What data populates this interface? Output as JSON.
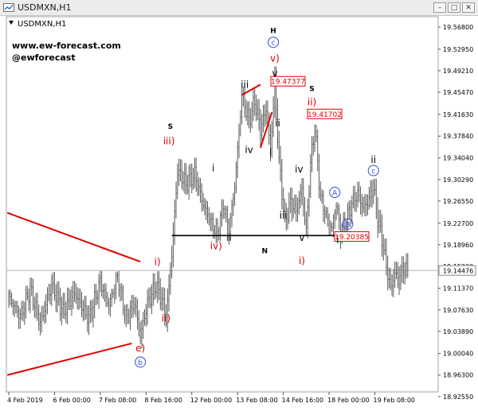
{
  "window": {
    "title": "USDMXN,H1",
    "buttons": [
      "minimize",
      "maximize",
      "close"
    ]
  },
  "chart_data": {
    "type": "candlestick",
    "symbol_label": "USDMXN,H1",
    "watermark": [
      "www.ew-forecast.com",
      "@ewforecast"
    ],
    "ylim": [
      18.935,
      19.575
    ],
    "y_ticks": [
      "19.56800",
      "19.52950",
      "19.49210",
      "19.45470",
      "19.41630",
      "19.37840",
      "19.34040",
      "19.30290",
      "19.26550",
      "19.22700",
      "19.18960",
      "19.15220",
      "19.11370",
      "19.07630",
      "19.03890",
      "19.00040",
      "18.96300",
      "18.92550"
    ],
    "y_tick_values": [
      19.568,
      19.5295,
      19.4921,
      19.4547,
      19.4163,
      19.3784,
      19.3404,
      19.3029,
      19.2655,
      19.227,
      19.1896,
      19.1522,
      19.1137,
      19.0763,
      19.0389,
      19.0004,
      18.963,
      18.9255
    ],
    "x_ticks": [
      "4 Feb 2019",
      "6 Feb 00:00",
      "7 Feb 08:00",
      "8 Feb 16:00",
      "12 Feb 00:00",
      "13 Feb 08:00",
      "14 Feb 16:00",
      "18 Feb 00:00",
      "19 Feb 08:00"
    ],
    "x_tick_bars": [
      0,
      32,
      64,
      96,
      128,
      160,
      192,
      224,
      256
    ],
    "current_price": "19.14476",
    "current_price_value": 19.14476,
    "price_boxes": [
      {
        "label": "19.47377",
        "value": 19.47377
      },
      {
        "label": "19.41702",
        "value": 19.41702
      },
      {
        "label": "19.20385",
        "value": 19.20385
      }
    ],
    "neckline_value": 19.2055,
    "wave_labels": [
      {
        "text": "H",
        "color": "#000000",
        "bold": true,
        "bar": 185,
        "value": 19.558
      },
      {
        "text": "c",
        "color": "#2e4bd6",
        "circled": true,
        "bar": 185,
        "value": 19.536
      },
      {
        "text": "v)",
        "color": "#d40000",
        "bar": 186,
        "value": 19.508
      },
      {
        "text": "v",
        "color": "#000000",
        "bar": 186,
        "value": 19.482
      },
      {
        "text": "iii",
        "color": "#000000",
        "bar": 165,
        "value": 19.462
      },
      {
        "text": "S",
        "color": "#000000",
        "bold": true,
        "bar": 212,
        "value": 19.457
      },
      {
        "text": "ii)",
        "color": "#d40000",
        "bar": 212,
        "value": 19.432
      },
      {
        "text": "ii",
        "color": "#000000",
        "bar": 188,
        "value": 19.395
      },
      {
        "text": "S",
        "color": "#000000",
        "bold": true,
        "bar": 113,
        "value": 19.391
      },
      {
        "text": "iii)",
        "color": "#d40000",
        "bar": 112,
        "value": 19.364
      },
      {
        "text": "iv",
        "color": "#000000",
        "bar": 168,
        "value": 19.349
      },
      {
        "text": "i",
        "color": "#000000",
        "bar": 183,
        "value": 19.344
      },
      {
        "text": "i",
        "color": "#000000",
        "bar": 143,
        "value": 19.317
      },
      {
        "text": "iv",
        "color": "#000000",
        "bar": 203,
        "value": 19.315
      },
      {
        "text": "ii",
        "color": "#000000",
        "bar": 255,
        "value": 19.332
      },
      {
        "text": "c",
        "color": "#2e4bd6",
        "circled": true,
        "bar": 255,
        "value": 19.313
      },
      {
        "text": "A",
        "color": "#2e4bd6",
        "circled": true,
        "bar": 228,
        "value": 19.275
      },
      {
        "text": "iii",
        "color": "#000000",
        "bar": 192,
        "value": 19.235
      },
      {
        "text": "B",
        "color": "#2e4bd6",
        "circled": true,
        "bar": 237,
        "value": 19.22
      },
      {
        "text": "ii",
        "color": "#000000",
        "bar": 154,
        "value": 19.196
      },
      {
        "text": "v",
        "color": "#000000",
        "bar": 205,
        "value": 19.196
      },
      {
        "text": "i",
        "color": "#000000",
        "bar": 230,
        "value": 19.192
      },
      {
        "text": "iv)",
        "color": "#d40000",
        "bar": 145,
        "value": 19.182
      },
      {
        "text": "N",
        "color": "#000000",
        "bold": true,
        "bar": 179,
        "value": 19.175
      },
      {
        "text": "i)",
        "color": "#d40000",
        "bar": 205,
        "value": 19.156
      },
      {
        "text": "i)",
        "color": "#d40000",
        "bar": 104,
        "value": 19.154
      },
      {
        "text": "ii)",
        "color": "#d40000",
        "bar": 110,
        "value": 19.056
      },
      {
        "text": "e)",
        "color": "#d40000",
        "bar": 92,
        "value": 19.004
      },
      {
        "text": "b",
        "color": "#2e4bd6",
        "circled": true,
        "bar": 92,
        "value": 18.98
      }
    ]
  }
}
